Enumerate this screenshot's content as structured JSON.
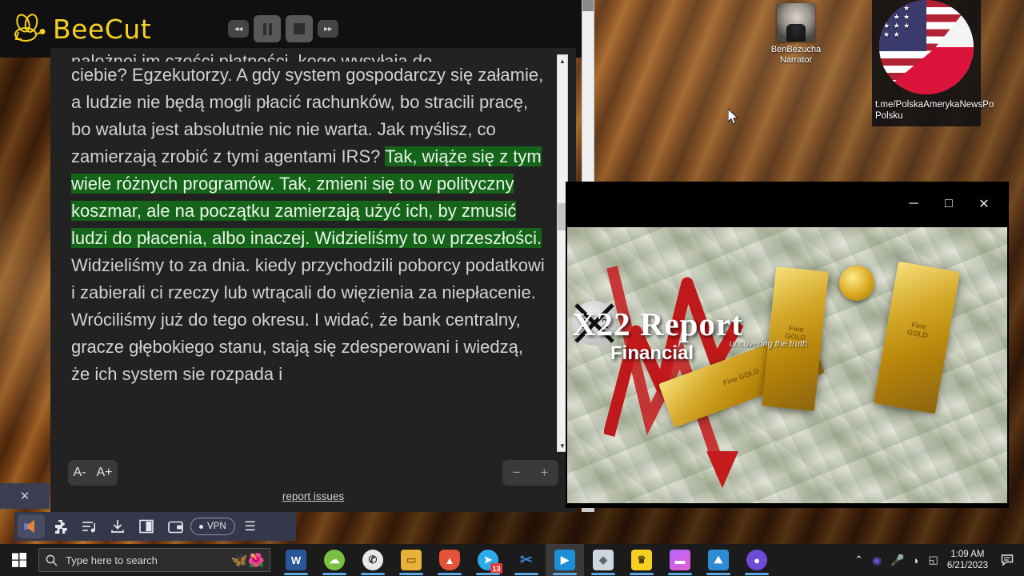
{
  "recorder": {
    "app_name": "BeeCut",
    "controls": [
      {
        "name": "rewind",
        "glyph": "◂◂"
      },
      {
        "name": "pause",
        "glyph": "‖"
      },
      {
        "name": "stop",
        "glyph": "■"
      },
      {
        "name": "forward",
        "glyph": "▸▸"
      }
    ],
    "accent_color": "#f5d020"
  },
  "reader": {
    "partial_top_line": "należnej im części płatności, kogo wysyłają do",
    "paragraph_before_highlight": "ciebie? Egzekutorzy. A gdy system gospodarczy się załamie, a ludzie nie będą mogli płacić rachunków, bo stracili pracę, bo waluta jest absolutnie nic nie warta. Jak myślisz, co zamierzają zrobić z tymi agentami IRS? ",
    "highlighted_text": "Tak, wiąże się z tym wiele różnych programów. Tak, zmieni się to w polityczny koszmar, ale na początku zamierzają użyć ich, by zmusić ludzi do płacenia, albo inaczej. Widzieliśmy to w przeszłości.",
    "paragraph_after_highlight": " Widzieliśmy to za dnia. kiedy przychodzili poborcy podatkowi i zabierali ci rzeczy lub wtrącali do więzienia za niepłacenie. Wróciliśmy już do tego okresu. I widać, że bank centralny, gracze głębokiego stanu, stają się zdesperowani i wiedzą, że ich system sie rozpada i",
    "highlight_color": "#15641a",
    "font_decrease_label": "A-",
    "font_increase_label": "A+",
    "zoom_out_label": "−",
    "zoom_in_label": "+",
    "report_issues_label": "report issues"
  },
  "brave_toolbar": {
    "items": [
      {
        "name": "brave-speaker-icon",
        "label": ""
      },
      {
        "name": "extensions-puzzle-icon",
        "label": ""
      },
      {
        "name": "playlist-icon",
        "label": ""
      },
      {
        "name": "downloads-icon",
        "label": ""
      },
      {
        "name": "sidebar-icon",
        "label": ""
      },
      {
        "name": "wallet-icon",
        "label": ""
      }
    ],
    "vpn_label": "VPN",
    "menu_label": "☰",
    "close_label": "✕"
  },
  "desktop": {
    "icons": [
      {
        "name": "narrator-shortcut",
        "label": "BenBezucha\nNarrator"
      },
      {
        "name": "telegram-channel-shortcut",
        "label": "t.me/PolskaAmerykaNewsPo Polsku"
      }
    ]
  },
  "video_window": {
    "title": "",
    "minimize_label": "─",
    "maximize_label": "□",
    "close_label": "✕",
    "logo_main": "X22 Report",
    "logo_sub": "Financial",
    "logo_tagline": "uncovering the truth",
    "badge_left": "2",
    "badge_right": "2",
    "gold_bar_label": "Fine GOLD"
  },
  "taskbar": {
    "search_placeholder": "Type here to search",
    "start_label": "",
    "apps": [
      {
        "name": "word",
        "glyph": "W",
        "color": "#2b579a",
        "badge": "",
        "open": true,
        "focused": false
      },
      {
        "name": "cloud-drive",
        "glyph": "☁",
        "color": "#7ac142",
        "badge": "",
        "open": true,
        "focused": false
      },
      {
        "name": "whatsapp",
        "glyph": "✆",
        "color": "#e8e8e8",
        "badge": "",
        "open": true,
        "focused": false
      },
      {
        "name": "file-explorer",
        "glyph": "▭",
        "color": "#e8b13a",
        "badge": "",
        "open": true,
        "focused": false
      },
      {
        "name": "brave-browser",
        "glyph": "▲",
        "color": "#e2533a",
        "badge": "",
        "open": true,
        "focused": false
      },
      {
        "name": "telegram",
        "glyph": "➤",
        "color": "#2aabee",
        "badge": "13",
        "open": true,
        "focused": false
      },
      {
        "name": "snipping-tool",
        "glyph": "✂",
        "color": "#3e7fd1",
        "badge": "",
        "open": true,
        "focused": false
      },
      {
        "name": "media-player",
        "glyph": "▶",
        "color": "#1d8fd6",
        "badge": "",
        "open": true,
        "focused": true
      },
      {
        "name": "3d-viewer",
        "glyph": "◆",
        "color": "#cfd6dd",
        "badge": "",
        "open": true,
        "focused": false
      },
      {
        "name": "beecut",
        "glyph": "♛",
        "color": "#f5d020",
        "badge": "",
        "open": true,
        "focused": false
      },
      {
        "name": "video-editor",
        "glyph": "▬",
        "color": "#a55ae0",
        "badge": "",
        "open": true,
        "focused": false
      },
      {
        "name": "photos",
        "glyph": "⛰",
        "color": "#2d8bd4",
        "badge": "",
        "open": true,
        "focused": false
      },
      {
        "name": "opera-browser",
        "glyph": "●",
        "color": "#6d4bd6",
        "badge": "",
        "open": true,
        "focused": false
      }
    ],
    "tray": {
      "show_hidden_label": "⌃",
      "items": [
        {
          "name": "opera-tray-icon",
          "glyph": "◉"
        },
        {
          "name": "microphone-icon",
          "glyph": "Ἲ4"
        },
        {
          "name": "wifi-icon",
          "glyph": "◠"
        },
        {
          "name": "display-icon",
          "glyph": "◰"
        }
      ],
      "time": "1:09 AM",
      "date": "6/21/2023",
      "notifications_label": "Ὕ2"
    }
  }
}
